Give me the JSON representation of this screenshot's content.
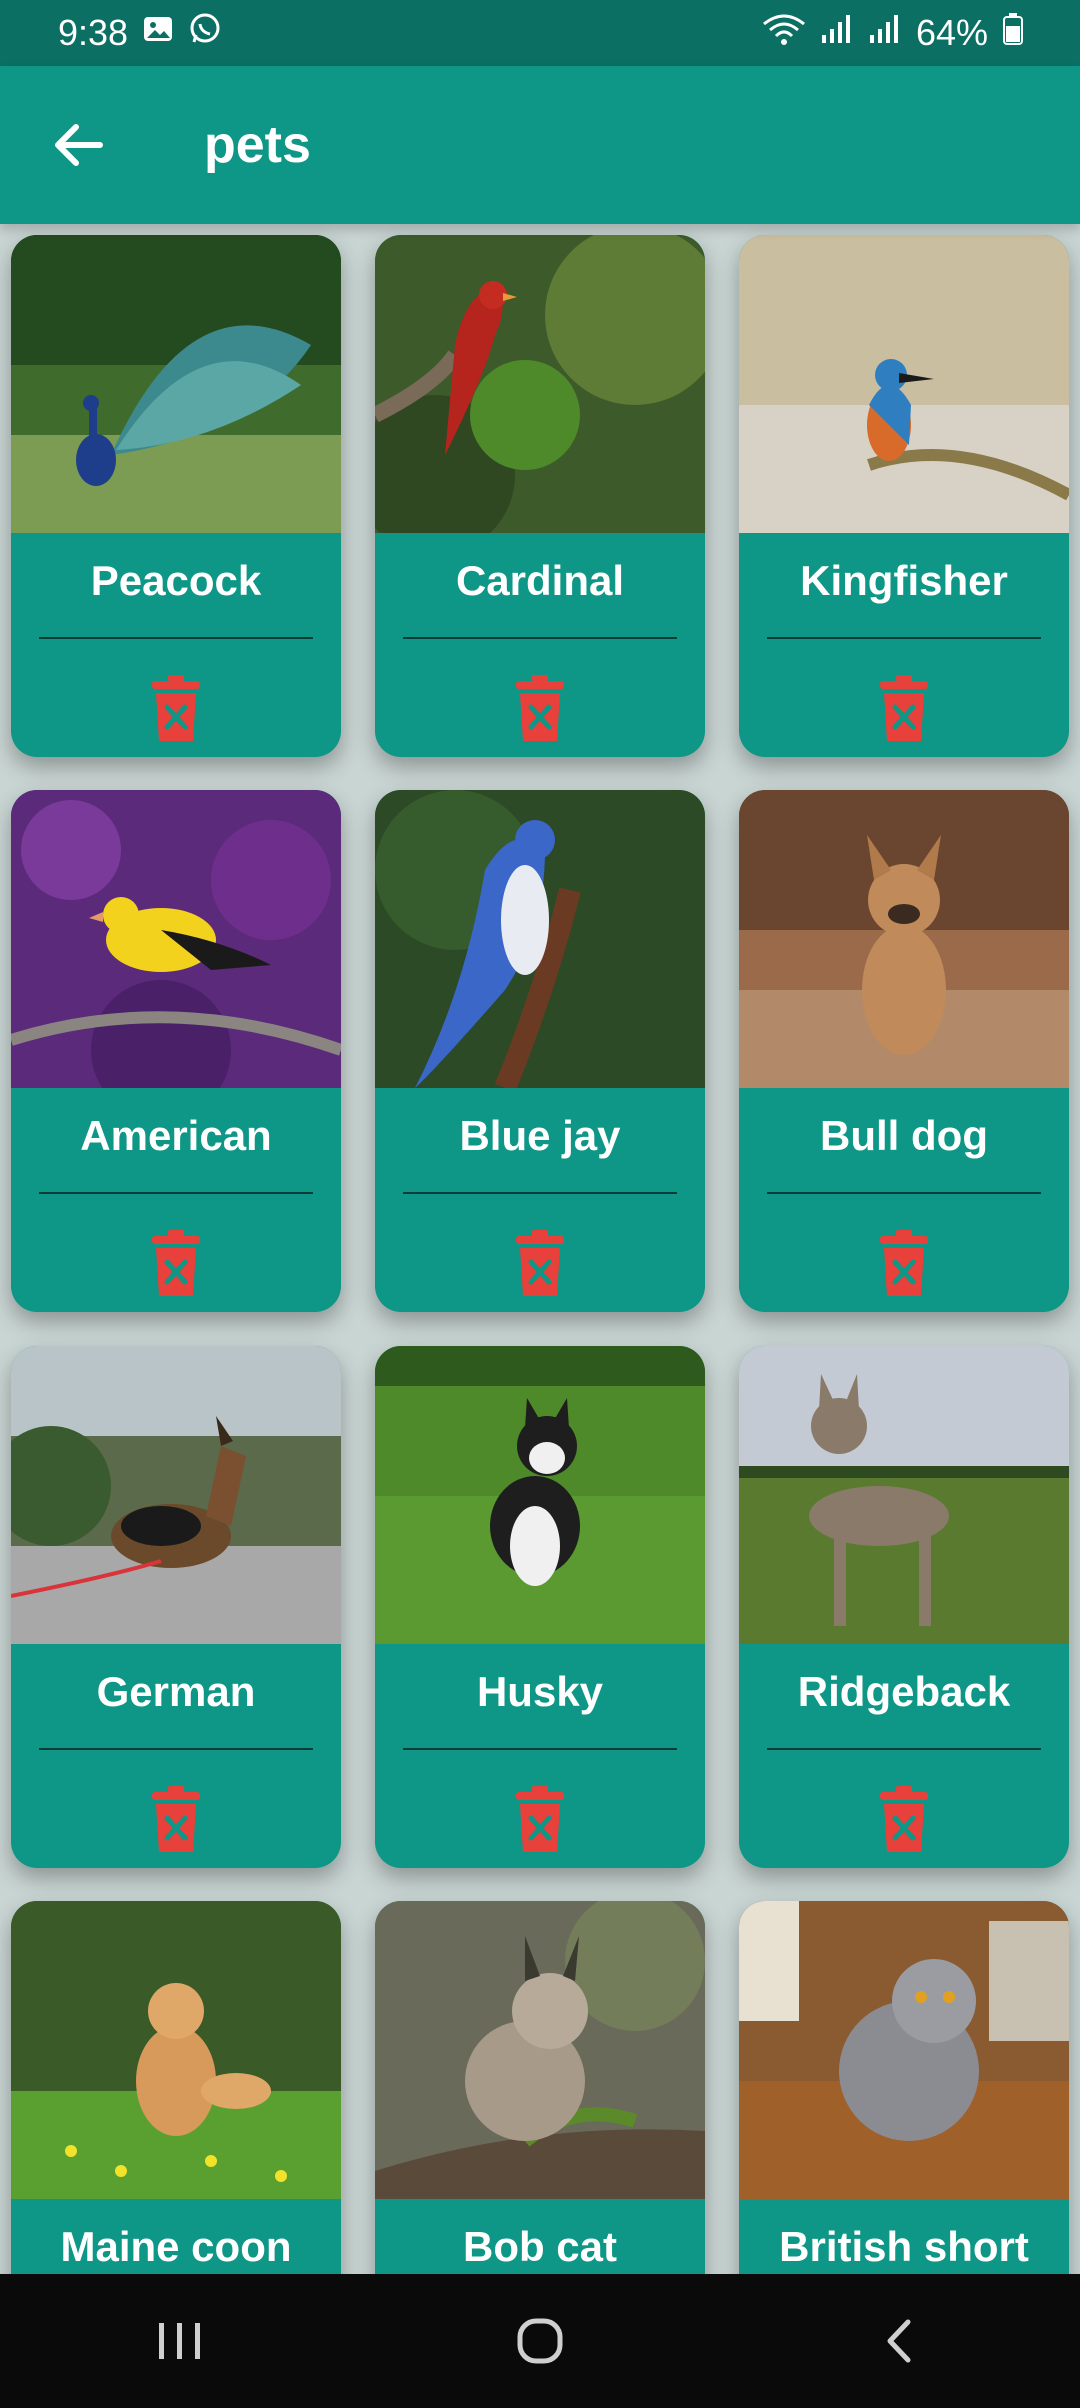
{
  "status_bar": {
    "time": "9:38",
    "battery": "64%",
    "icons_left": [
      "gallery-icon",
      "whatsapp-icon"
    ],
    "icons_right": [
      "wifi-icon",
      "signal-icon",
      "signal-icon",
      "battery-icon"
    ]
  },
  "app_bar": {
    "title": "pets",
    "back_icon": "arrow-left-icon"
  },
  "colors": {
    "status_bar": "#0b6f63",
    "app_bar": "#0e9686",
    "card": "#0e9686",
    "delete": "#e8403a",
    "background": "#c9d5d3"
  },
  "pets": [
    {
      "name": "Peacock"
    },
    {
      "name": "Cardinal"
    },
    {
      "name": "Kingfisher"
    },
    {
      "name": "American"
    },
    {
      "name": "Blue jay"
    },
    {
      "name": "Bull dog"
    },
    {
      "name": "German"
    },
    {
      "name": "Husky"
    },
    {
      "name": "Ridgeback"
    },
    {
      "name": "Maine coon"
    },
    {
      "name": "Bob cat"
    },
    {
      "name": "British short"
    }
  ],
  "nav_bar": {
    "buttons": [
      "recent-apps-icon",
      "home-icon",
      "back-icon"
    ]
  }
}
